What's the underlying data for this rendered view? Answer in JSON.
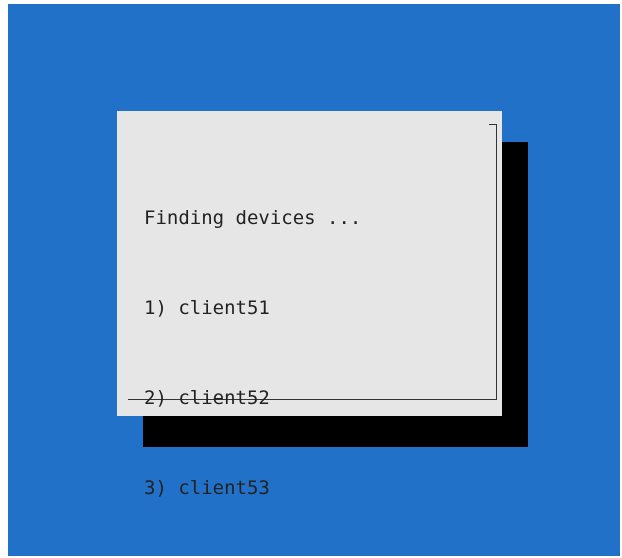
{
  "dialog": {
    "status": "Finding devices ...",
    "devices": [
      "1) client51",
      "2) client52",
      "3) client53"
    ]
  },
  "colors": {
    "background": "#2271c9",
    "dialog": "#e6e6e6",
    "shadow": "#000000"
  }
}
